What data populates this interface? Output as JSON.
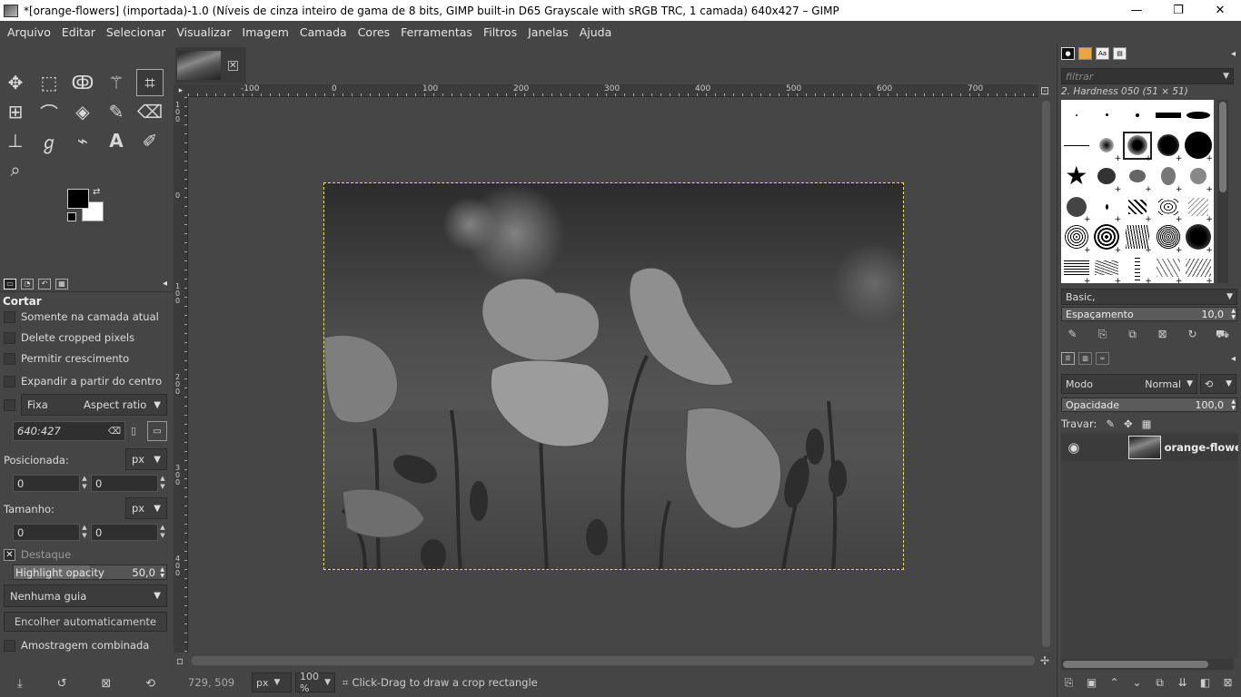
{
  "window": {
    "title": "*[orange-flowers] (importada)-1.0 (Níveis de cinza inteiro de gama de 8 bits, GIMP built-in D65 Grayscale with sRGB TRC, 1 camada) 640x427 – GIMP",
    "minimize": "—",
    "maximize": "❐",
    "close": "✕"
  },
  "menu": [
    "Arquivo",
    "Editar",
    "Selecionar",
    "Visualizar",
    "Imagem",
    "Camada",
    "Cores",
    "Ferramentas",
    "Filtros",
    "Janelas",
    "Ajuda"
  ],
  "tools": [
    {
      "name": "move-tool-icon",
      "glyph": "✥"
    },
    {
      "name": "rect-select-tool-icon",
      "glyph": "⬚"
    },
    {
      "name": "lasso-tool-icon",
      "glyph": "ↂ"
    },
    {
      "name": "fuzzy-select-tool-icon",
      "glyph": "⚚"
    },
    {
      "name": "crop-tool-icon",
      "glyph": "⌗"
    },
    {
      "name": "unified-transform-tool-icon",
      "glyph": "⊞"
    },
    {
      "name": "warp-transform-tool-icon",
      "glyph": "⌒"
    },
    {
      "name": "bucket-fill-tool-icon",
      "glyph": "◈"
    },
    {
      "name": "paintbrush-tool-icon",
      "glyph": "✎"
    },
    {
      "name": "eraser-tool-icon",
      "glyph": "⌫"
    },
    {
      "name": "clone-tool-icon",
      "glyph": "⊥"
    },
    {
      "name": "smudge-tool-icon",
      "glyph": "ℊ"
    },
    {
      "name": "paths-tool-icon",
      "glyph": "⌁"
    },
    {
      "name": "text-tool-icon",
      "glyph": "A"
    },
    {
      "name": "color-picker-tool-icon",
      "glyph": "✐"
    },
    {
      "name": "zoom-tool-icon",
      "glyph": "⌕"
    }
  ],
  "tool_options": {
    "title": "Cortar",
    "current_layer_only": "Somente na camada atual",
    "delete_cropped": "Delete cropped pixels",
    "allow_growing": "Permitir crescimento",
    "expand_from_center": "Expandir a partir do centro",
    "fixed_label": "Fixa",
    "fixed_mode": "Aspect ratio",
    "ratio_value": "640:427",
    "position_label": "Posicionada:",
    "position_unit": "px",
    "position_x": "0",
    "position_y": "0",
    "size_label": "Tamanho:",
    "size_unit": "px",
    "size_w": "0",
    "size_h": "0",
    "highlight_label": "Destaque",
    "highlight_opacity_label": "Highlight opacity",
    "highlight_opacity_value": "50,0",
    "highlight_opacity_fraction": 0.5,
    "guides": "Nenhuma guia",
    "auto_shrink": "Encolher automaticamente",
    "sample_merged": "Amostragem combinada"
  },
  "rulers": {
    "h_labels": [
      "-100",
      "0",
      "100",
      "200",
      "300",
      "400",
      "500",
      "600",
      "700"
    ],
    "v_labels": [
      "100",
      "0",
      "100",
      "200",
      "300",
      "400"
    ]
  },
  "statusbar": {
    "coords": "729, 509",
    "unit": "px",
    "zoom": "100 %",
    "message": "Click-Drag to draw a crop rectangle"
  },
  "brushes": {
    "filter_placeholder": "filtrar",
    "selected": "2. Hardness 050 (51 × 51)",
    "tag": "Basic,",
    "spacing_label": "Espaçamento",
    "spacing_value": "10,0"
  },
  "layers": {
    "mode_label": "Modo",
    "mode_value": "Normal",
    "opacity_label": "Opacidade",
    "opacity_value": "100,0",
    "lock_label": "Travar:",
    "layer_name": "orange-flowers"
  }
}
